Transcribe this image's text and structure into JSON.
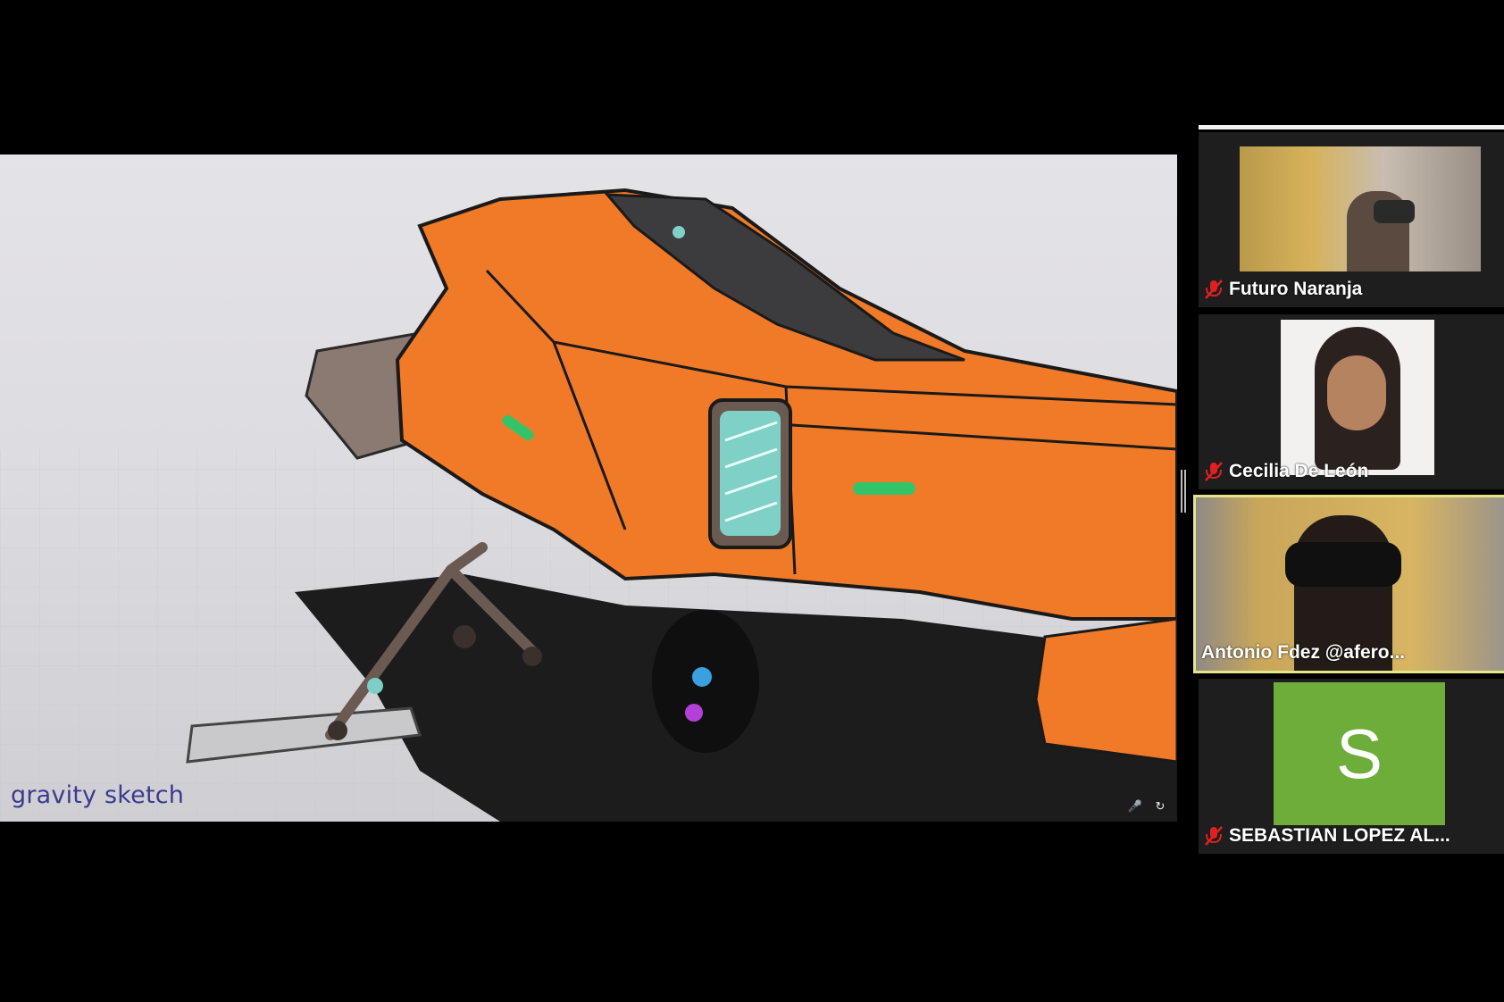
{
  "share": {
    "brand_text": "gravity sketch",
    "controls": [
      {
        "icon": "mic-icon"
      },
      {
        "icon": "refresh-icon"
      }
    ]
  },
  "participants": [
    {
      "name": "Futuro Naranja",
      "muted": true,
      "video": "vr-headset-room",
      "active": false
    },
    {
      "name": "Cecilia De León",
      "muted": true,
      "video": "portrait",
      "active": false
    },
    {
      "name": "Antonio Fdez @afero...",
      "muted": false,
      "video": "vr-headset-blinds",
      "active": true
    },
    {
      "name": "SEBASTIAN LOPEZ AL...",
      "muted": true,
      "video": "avatar",
      "avatar_letter": "S",
      "active": false
    }
  ],
  "colors": {
    "ship_orange": "#f07a28",
    "active_speaker_border": "#e5e48a",
    "avatar_green": "#6dae3a",
    "muted_red": "#e02020",
    "brand_text": "#3b3b8f"
  }
}
